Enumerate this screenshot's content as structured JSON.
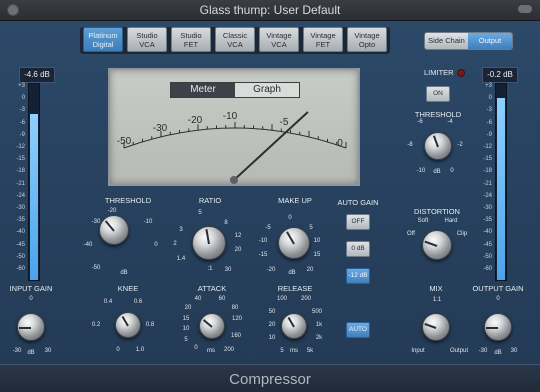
{
  "window": {
    "title": "Glass thump: User Default"
  },
  "models": [
    "Platinum\nDigital",
    "Studio\nVCA",
    "Studio\nFET",
    "Classic\nVCA",
    "Vintage\nVCA",
    "Vintage\nFET",
    "Vintage\nOpto"
  ],
  "model_selected": "Platinum Digital",
  "sidechain": {
    "side_chain": "Side Chain",
    "output": "Output",
    "selected": "Output"
  },
  "meter": {
    "tabs": [
      "Meter",
      "Graph"
    ],
    "selected_tab": "Meter",
    "scale": [
      "-50",
      "-30",
      "-20",
      "-10",
      "-5",
      "0"
    ],
    "needle_db": -4
  },
  "input_meter": {
    "value": "-4.6 dB",
    "level_db": -6,
    "scale": [
      "+3",
      "0",
      "-3",
      "-6",
      "-9",
      "-12",
      "-15",
      "-18",
      "-21",
      "-24",
      "-30",
      "-35",
      "-40",
      "-45",
      "-50",
      "-60"
    ]
  },
  "output_meter": {
    "value": "-0.2 dB",
    "level_db": -1,
    "scale": [
      "+3",
      "0",
      "-3",
      "-6",
      "-9",
      "-12",
      "-15",
      "-18",
      "-21",
      "-24",
      "-30",
      "-35",
      "-40",
      "-45",
      "-50",
      "-60"
    ]
  },
  "controls": {
    "threshold": {
      "label": "THRESHOLD",
      "ticks": [
        "-50",
        "-40",
        "-30",
        "-20",
        "-10",
        "0"
      ],
      "unit": "dB"
    },
    "ratio": {
      "label": "RATIO",
      "ticks": [
        "1.4",
        "2",
        "3",
        "5",
        "8",
        "12",
        "20",
        "30"
      ],
      "unit": ":1"
    },
    "makeup": {
      "label": "MAKE UP",
      "ticks": [
        "-20",
        "-15",
        "-10",
        "-5",
        "0",
        "5",
        "10",
        "15",
        "20"
      ],
      "unit": "dB"
    },
    "knee": {
      "label": "KNEE",
      "ticks": [
        "0",
        "0.2",
        "0.4",
        "0.6",
        "0.8",
        "1.0"
      ]
    },
    "attack": {
      "label": "ATTACK",
      "ticks": [
        "0",
        "5",
        "10",
        "15",
        "20",
        "40",
        "60",
        "80",
        "120",
        "160",
        "200"
      ],
      "unit": "ms"
    },
    "release": {
      "label": "RELEASE",
      "ticks": [
        "5",
        "10",
        "20",
        "50",
        "100",
        "200",
        "500",
        "1k",
        "2k",
        "5k"
      ],
      "unit": "ms"
    },
    "input_gain": {
      "label": "INPUT GAIN",
      "ticks": [
        "-30",
        "0",
        "30"
      ],
      "unit": "dB"
    },
    "limiter": {
      "label": "LIMITER",
      "button": "ON"
    },
    "limiter_threshold": {
      "label": "THRESHOLD",
      "ticks": [
        "-10",
        "-8",
        "-6",
        "-4",
        "-2",
        "0"
      ],
      "unit": "dB"
    },
    "distortion": {
      "label": "DISTORTION",
      "ticks": [
        "Off",
        "Soft",
        "Hard",
        "Clip"
      ]
    },
    "mix": {
      "label": "MIX",
      "ticks": [
        "1:1",
        "Input",
        "Output"
      ]
    },
    "output_gain": {
      "label": "OUTPUT GAIN",
      "ticks": [
        "-30",
        "0",
        "30"
      ],
      "unit": "dB"
    }
  },
  "auto_gain": {
    "label": "AUTO GAIN",
    "buttons": [
      "OFF",
      "0 dB",
      "-12 dB"
    ],
    "selected": "-12 dB"
  },
  "auto_release": "AUTO",
  "footer": {
    "title": "Compressor"
  },
  "colors": {
    "accent": "#4a90d0",
    "panel": "#27415e"
  }
}
